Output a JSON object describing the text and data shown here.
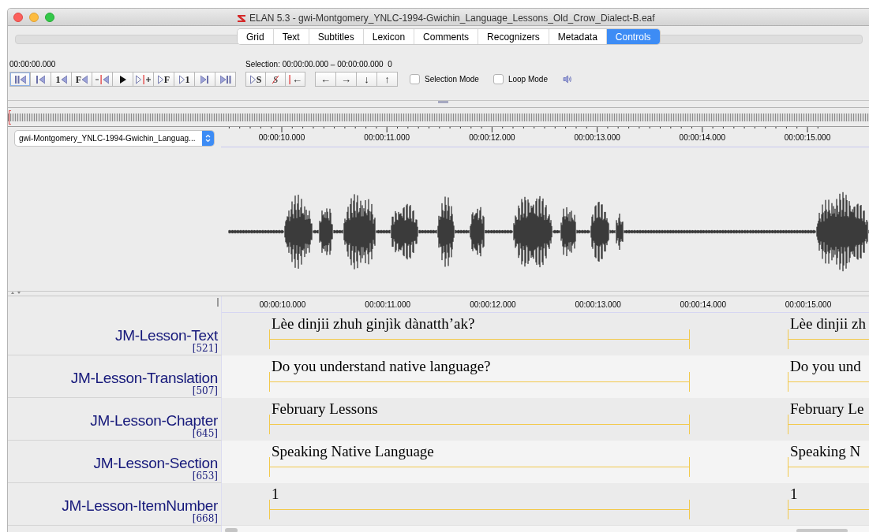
{
  "window": {
    "title": "ELAN 5.3 - gwi-Montgomery_YNLC-1994-Gwichin_Language_Lessons_Old_Crow_Dialect-B.eaf"
  },
  "tabs": [
    {
      "label": "Grid",
      "selected": false
    },
    {
      "label": "Text",
      "selected": false
    },
    {
      "label": "Subtitles",
      "selected": false
    },
    {
      "label": "Lexicon",
      "selected": false
    },
    {
      "label": "Comments",
      "selected": false
    },
    {
      "label": "Recognizers",
      "selected": false
    },
    {
      "label": "Metadata",
      "selected": false
    },
    {
      "label": "Controls",
      "selected": true
    }
  ],
  "controls": {
    "current_time": "00:00:00.000",
    "transport_buttons": [
      {
        "kind": "to-start"
      },
      {
        "kind": "step-back"
      },
      {
        "kind": "text-back",
        "label": "1"
      },
      {
        "kind": "text-back",
        "label": "F"
      },
      {
        "kind": "cursor-back"
      },
      {
        "kind": "play"
      },
      {
        "kind": "play-cursor"
      },
      {
        "kind": "text-forward",
        "label": "F"
      },
      {
        "kind": "text-forward",
        "label": "1"
      },
      {
        "kind": "step-forward"
      },
      {
        "kind": "to-end"
      }
    ],
    "selection": "Selection: 00:00:00.000 – 00:00:00.000  0",
    "selection_buttons": [
      {
        "kind": "text-forward",
        "label": "S"
      },
      {
        "kind": "struck",
        "label": "S"
      },
      {
        "kind": "cursor-text",
        "label": "←"
      }
    ],
    "nav_buttons": [
      {
        "label": "←"
      },
      {
        "label": "→"
      },
      {
        "label": "↓"
      },
      {
        "label": "↑"
      }
    ],
    "checkboxes": [
      {
        "label": "Selection Mode",
        "checked": false
      },
      {
        "label": "Loop Mode",
        "checked": false
      }
    ]
  },
  "waveform": {
    "media_select": "gwi-Montgomery_YNLC-1994-Gwichin_Languag...",
    "ruler": [
      "00:00:10.000",
      "00:00:11.000",
      "00:00:12.000",
      "00:00:13.000",
      "00:00:14.000",
      "00:00:15.000"
    ]
  },
  "tiers": {
    "ruler": [
      "00:00:10.000",
      "00:00:11.000",
      "00:00:12.000",
      "00:00:13.000",
      "00:00:14.000",
      "00:00:15.000"
    ],
    "rows": [
      {
        "name": "JM-Lesson-Text",
        "count": "[521]",
        "annotations": [
          "Lèe dinjii zhuh ginjìk dànatth’ak?",
          "Lèe dinjii zh"
        ]
      },
      {
        "name": "JM-Lesson-Translation",
        "count": "[507]",
        "annotations": [
          "Do you understand native language?",
          "Do you und"
        ]
      },
      {
        "name": "JM-Lesson-Chapter",
        "count": "[645]",
        "annotations": [
          "February Lessons",
          "February Le"
        ]
      },
      {
        "name": "JM-Lesson-Section",
        "count": "[653]",
        "annotations": [
          "Speaking Native Language",
          "Speaking N"
        ]
      },
      {
        "name": "JM-Lesson-ItemNumber",
        "count": "[668]",
        "annotations": [
          "1",
          "1"
        ]
      }
    ]
  }
}
